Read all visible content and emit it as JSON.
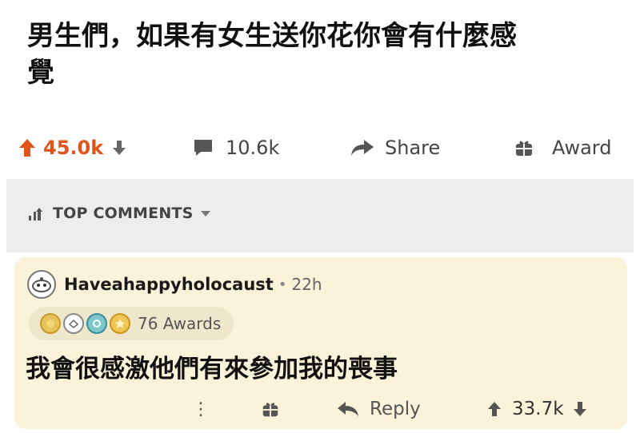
{
  "post": {
    "title": "男生們，如果有女生送你花你會有什麼感覺"
  },
  "actions": {
    "upvote_icon": "arrow-up-icon",
    "vote_count": "45.0k",
    "downvote_icon": "arrow-down-icon",
    "comments_icon": "comment-bubble-icon",
    "comments_count": "10.6k",
    "share_icon": "share-arrow-icon",
    "share_label": "Share",
    "award_icon": "gift-icon",
    "award_label": "Award",
    "upvote_color": "#e0541c"
  },
  "sort": {
    "icon": "sort-bars-icon",
    "label": "TOP COMMENTS",
    "chevron": "chevron-down-icon"
  },
  "comment": {
    "username": "Haveahappyholocaust",
    "separator": "•",
    "timestamp": "22h",
    "awards_count": "76 Awards",
    "body": "我會很感激他們有來參加我的喪事",
    "more_label": "⋮",
    "award_icon": "gift-icon",
    "reply_icon": "reply-arrow-icon",
    "reply_label": "Reply",
    "vote_count": "33.7k",
    "card_color": "#faf3da"
  }
}
